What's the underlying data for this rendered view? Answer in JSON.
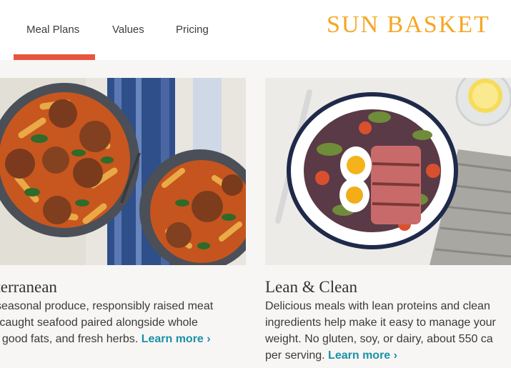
{
  "nav": {
    "items": [
      "Meal Plans",
      "Values",
      "Pricing"
    ],
    "active_index": 0
  },
  "logo": {
    "text": "SUN BASKET"
  },
  "colors": {
    "accent": "#e8553e",
    "logo": "#f5a623",
    "link": "#1b91a8",
    "page_bg": "#f7f6f4"
  },
  "cards": [
    {
      "title": "iterranean",
      "lines": [
        "seasonal produce, responsibly raised meat",
        "-caught seafood paired alongside whole",
        ", good fats, and fresh herbs."
      ],
      "learn_more": "Learn more ›",
      "image": "pasta-meatballs-photo"
    },
    {
      "title": "Lean & Clean",
      "lines": [
        "Delicious meals with lean proteins and clean",
        "ingredients help make it easy to manage your",
        "weight. No gluten, soy, or dairy, about 550 ca",
        "per serving."
      ],
      "learn_more": "Learn more ›",
      "image": "tuna-nicoise-salad-photo"
    }
  ]
}
